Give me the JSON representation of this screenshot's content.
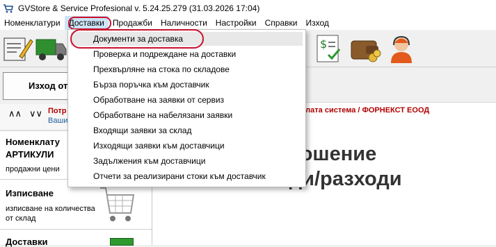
{
  "window": {
    "title": "GVStore & Service Profesional v. 5.24.25.279 (31.03.2026 17:04)"
  },
  "menu": {
    "items": [
      "Номенклатури",
      "Доставки",
      "Продажби",
      "Наличности",
      "Настройки",
      "Справки",
      "Изход"
    ],
    "active_index": 1
  },
  "toolbar": {
    "icons": [
      "document-edit-icon",
      "truck-icon",
      "money-check-icon",
      "wallet-icon",
      "support-agent-icon"
    ]
  },
  "delivery_menu": {
    "items": [
      "Документи за доставка",
      "Проверка и подреждане на доставки",
      "Прехвърляне на стока по складове",
      "Бърза поръчка към доставчик",
      "Обработване на заявки от сервиз",
      "Обработване на набелязани заявки",
      "Входящи заявки за склад",
      "Изходящи заявки към доставчици",
      "Задължения към доставчици",
      "Отчети за реализирани стоки към доставчик"
    ],
    "highlighted_index": 0
  },
  "left_panel": {
    "exit_label": "Изход от",
    "side_red": "Потр",
    "side_blue": "Ваши",
    "cards": [
      {
        "title_line1": "Номенклату",
        "title_line2": "АРТИКУЛИ",
        "subtitle": "продажни цени"
      },
      {
        "title": "Изписване",
        "subtitle_line1": "изписване на количества",
        "subtitle_line2": "от склад"
      },
      {
        "title": "Доставки"
      }
    ]
  },
  "main": {
    "company_line": "цялата система / ФОРНЕКСТ ЕООД",
    "heading_line1": "отношение",
    "heading_line2": "ходи/разходи"
  },
  "colors": {
    "highlight_oval": "#c8102e",
    "company_text": "#b00000"
  }
}
